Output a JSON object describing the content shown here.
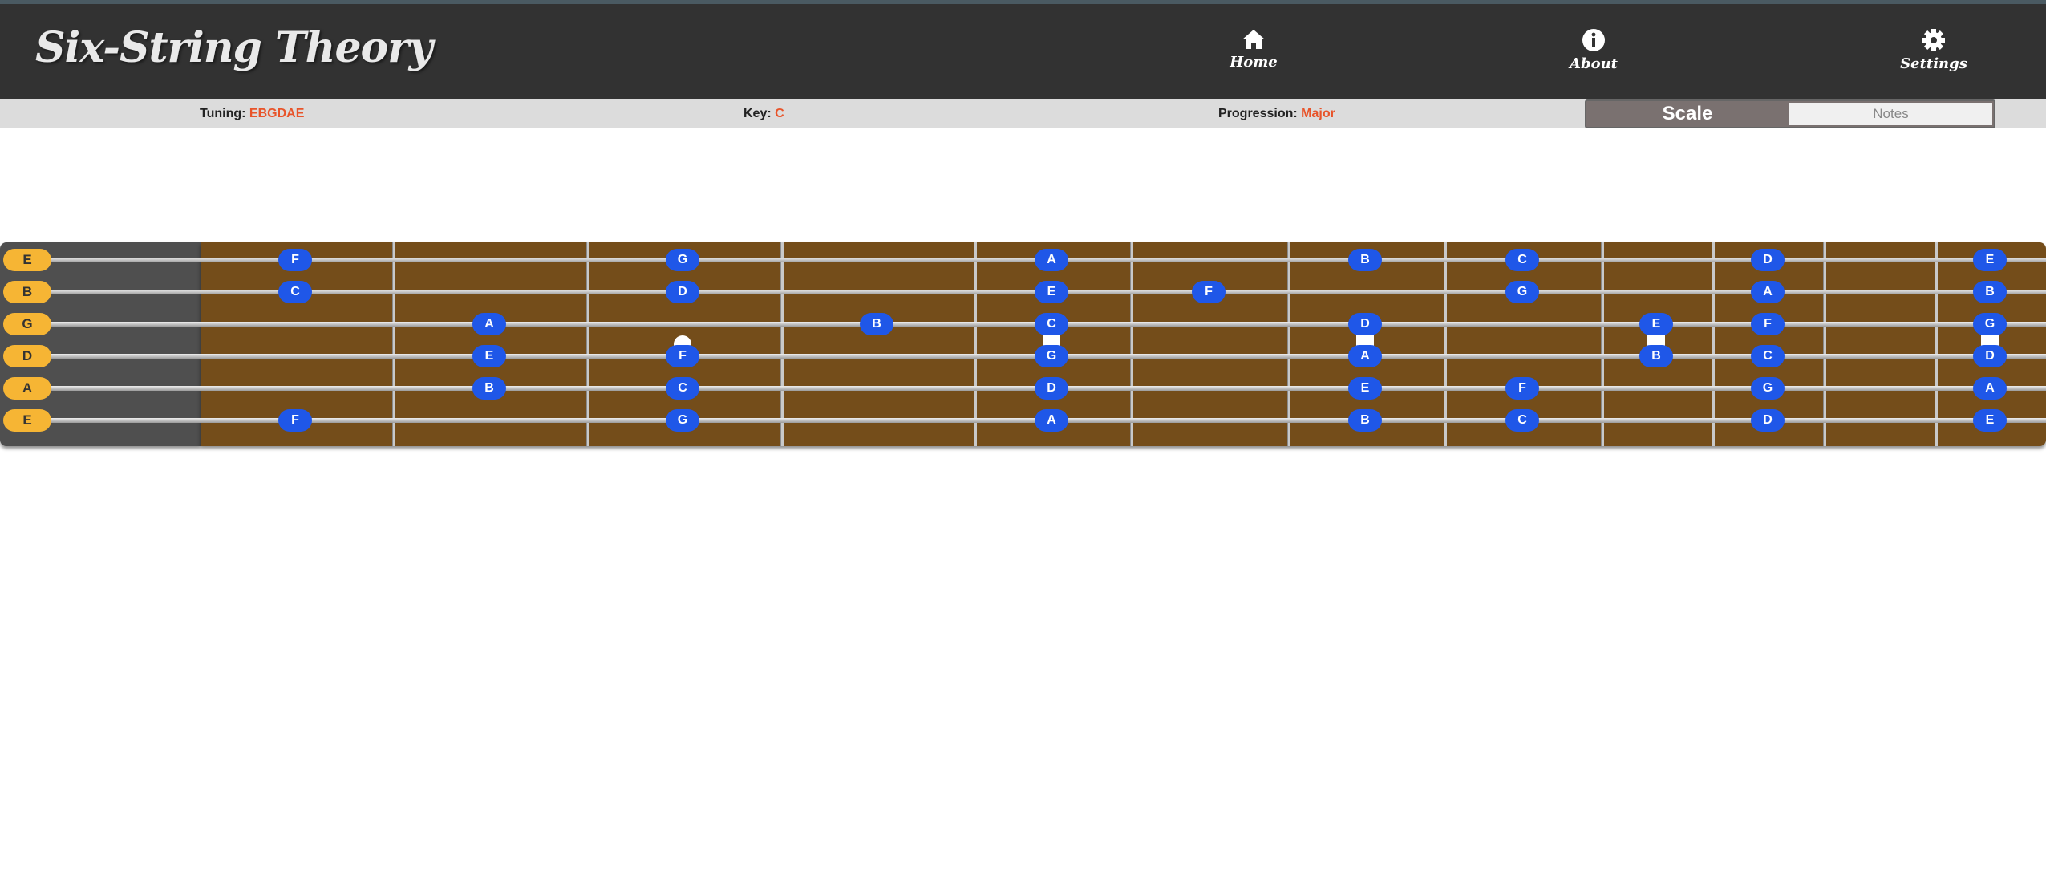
{
  "app": {
    "logo": "Six-String Theory",
    "nav": [
      {
        "label": "Home",
        "icon": "home-icon"
      },
      {
        "label": "About",
        "icon": "info-icon"
      },
      {
        "label": "Settings",
        "icon": "gear-icon"
      }
    ]
  },
  "info": {
    "tuning_label": "Tuning: ",
    "tuning_value": "EBGDAE",
    "key_label": "Key: ",
    "key_value": "C",
    "progression_label": "Progression: ",
    "progression_value": "Major"
  },
  "toggle": {
    "scale_label": "Scale",
    "notes_label": "Notes",
    "active": "Scale"
  },
  "colors": {
    "header_bg": "#323232",
    "accent": "#e8542a",
    "fretboard": "#744d1a",
    "note_dot": "#1f57e8",
    "open_note": "#f6b534"
  },
  "fretboard": {
    "open_strings": [
      "E",
      "B",
      "G",
      "D",
      "A",
      "E"
    ],
    "fret_count": 12,
    "inlay_frets": [
      3,
      5,
      7,
      9,
      12
    ],
    "strings": [
      {
        "open": "E",
        "notes": [
          {
            "fret": 1,
            "note": "F"
          },
          {
            "fret": 3,
            "note": "G"
          },
          {
            "fret": 5,
            "note": "A"
          },
          {
            "fret": 7,
            "note": "B"
          },
          {
            "fret": 8,
            "note": "C"
          },
          {
            "fret": 10,
            "note": "D"
          },
          {
            "fret": 12,
            "note": "E"
          }
        ]
      },
      {
        "open": "B",
        "notes": [
          {
            "fret": 1,
            "note": "C"
          },
          {
            "fret": 3,
            "note": "D"
          },
          {
            "fret": 5,
            "note": "E"
          },
          {
            "fret": 6,
            "note": "F"
          },
          {
            "fret": 8,
            "note": "G"
          },
          {
            "fret": 10,
            "note": "A"
          },
          {
            "fret": 12,
            "note": "B"
          }
        ]
      },
      {
        "open": "G",
        "notes": [
          {
            "fret": 2,
            "note": "A"
          },
          {
            "fret": 4,
            "note": "B"
          },
          {
            "fret": 5,
            "note": "C"
          },
          {
            "fret": 7,
            "note": "D"
          },
          {
            "fret": 9,
            "note": "E"
          },
          {
            "fret": 10,
            "note": "F"
          },
          {
            "fret": 12,
            "note": "G"
          }
        ]
      },
      {
        "open": "D",
        "notes": [
          {
            "fret": 2,
            "note": "E"
          },
          {
            "fret": 3,
            "note": "F"
          },
          {
            "fret": 5,
            "note": "G"
          },
          {
            "fret": 7,
            "note": "A"
          },
          {
            "fret": 9,
            "note": "B"
          },
          {
            "fret": 10,
            "note": "C"
          },
          {
            "fret": 12,
            "note": "D"
          }
        ]
      },
      {
        "open": "A",
        "notes": [
          {
            "fret": 2,
            "note": "B"
          },
          {
            "fret": 3,
            "note": "C"
          },
          {
            "fret": 5,
            "note": "D"
          },
          {
            "fret": 7,
            "note": "E"
          },
          {
            "fret": 8,
            "note": "F"
          },
          {
            "fret": 10,
            "note": "G"
          },
          {
            "fret": 12,
            "note": "A"
          }
        ]
      },
      {
        "open": "E",
        "notes": [
          {
            "fret": 1,
            "note": "F"
          },
          {
            "fret": 3,
            "note": "G"
          },
          {
            "fret": 5,
            "note": "A"
          },
          {
            "fret": 7,
            "note": "B"
          },
          {
            "fret": 8,
            "note": "C"
          },
          {
            "fret": 10,
            "note": "D"
          },
          {
            "fret": 12,
            "note": "E"
          }
        ]
      }
    ]
  }
}
